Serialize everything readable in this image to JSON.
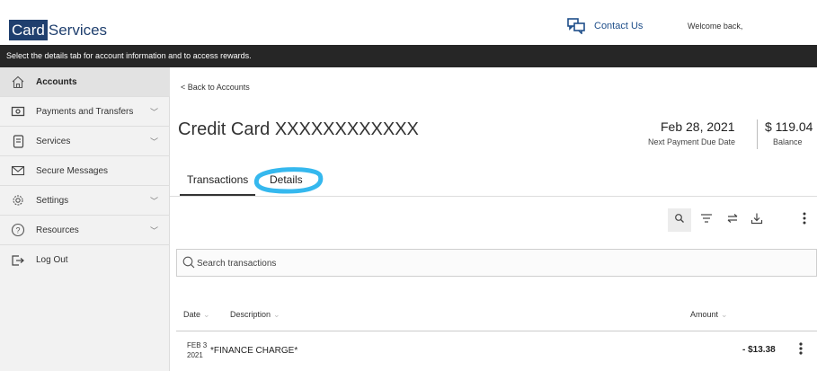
{
  "header": {
    "logo_box": "Card",
    "logo_text": "Services",
    "contact_label": "Contact Us",
    "welcome": "Welcome back,"
  },
  "banner": {
    "text": "Select the details tab for account information and to access rewards."
  },
  "sidebar": {
    "items": [
      {
        "label": "Accounts",
        "icon": "home-icon",
        "has_chevron": false,
        "active": true
      },
      {
        "label": "Payments and Transfers",
        "icon": "money-icon",
        "has_chevron": true
      },
      {
        "label": "Services",
        "icon": "document-icon",
        "has_chevron": true
      },
      {
        "label": "Secure Messages",
        "icon": "envelope-icon",
        "has_chevron": false
      },
      {
        "label": "Settings",
        "icon": "gear-icon",
        "has_chevron": true
      },
      {
        "label": "Resources",
        "icon": "help-icon",
        "has_chevron": true
      },
      {
        "label": "Log Out",
        "icon": "logout-icon",
        "has_chevron": false
      }
    ]
  },
  "main": {
    "back_link": "< Back to Accounts",
    "title": "Credit Card XXXXXXXXXXXX",
    "due_date": "Feb 28, 2021",
    "due_label": "Next Payment Due Date",
    "balance_amount": "$ 119.04",
    "balance_label": "Balance",
    "tabs": [
      {
        "label": "Transactions",
        "active": true
      },
      {
        "label": "Details",
        "active": false,
        "highlight_color": "#35b8ee"
      }
    ],
    "toolbar_icons": [
      "search-icon",
      "filter-icon",
      "swap-icon",
      "download-icon",
      "more-vertical-icon"
    ],
    "search_placeholder": "Search transactions",
    "columns": {
      "date": "Date",
      "description": "Description",
      "amount": "Amount"
    },
    "transactions": [
      {
        "date_line1": "FEB 3",
        "date_line2": "2021",
        "description": "*FINANCE CHARGE*",
        "amount": "- $13.38"
      }
    ]
  },
  "colors": {
    "brand": "#1f3f6e",
    "banner_bg": "#262626",
    "highlight": "#35b8ee"
  }
}
